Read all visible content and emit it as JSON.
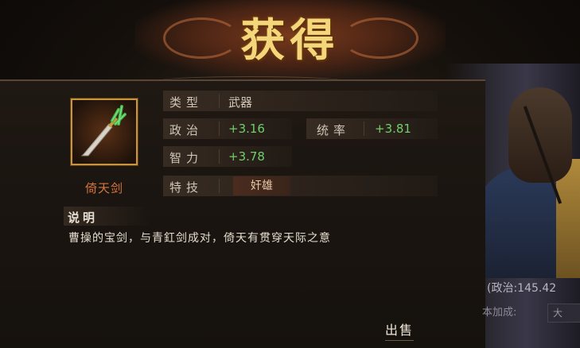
{
  "header": {
    "title": "获得"
  },
  "item": {
    "name": "倚天剑",
    "icon": "sword-icon",
    "accent_color": "#c7953c"
  },
  "stats": {
    "type_label": "类型",
    "type_value": "武器",
    "politics_label": "政治",
    "politics_value": "+3.16",
    "command_label": "统率",
    "command_value": "+3.81",
    "intellect_label": "智力",
    "intellect_value": "+3.78",
    "skill_label": "特技",
    "skill_value": "奸雄"
  },
  "description": {
    "label": "说明",
    "text": "曹操的宝剑，与青釭剑成对，倚天有贯穿天际之意"
  },
  "actions": {
    "sell_label": "出售"
  },
  "side_panel": {
    "politics_text": "(政治:145.42",
    "bonus_label": "本加成:",
    "box_text": "大"
  },
  "colors": {
    "bonus_green": "#6fd06a",
    "title_gold": "#f3d77a",
    "item_name": "#d8763a"
  }
}
